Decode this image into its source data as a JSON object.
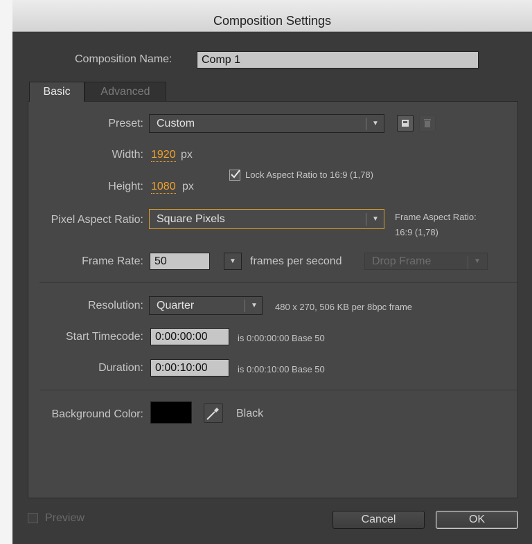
{
  "dialog": {
    "title": "Composition Settings"
  },
  "composition_name": {
    "label": "Composition Name:",
    "value": "Comp 1"
  },
  "tabs": [
    {
      "label": "Basic",
      "active": true
    },
    {
      "label": "Advanced",
      "active": false
    }
  ],
  "basic": {
    "preset": {
      "label": "Preset:",
      "value": "Custom"
    },
    "width": {
      "label": "Width:",
      "value": "1920",
      "unit": "px"
    },
    "height": {
      "label": "Height:",
      "value": "1080",
      "unit": "px"
    },
    "lock_aspect": {
      "label": "Lock Aspect Ratio to 16:9 (1,78)",
      "checked": true
    },
    "pixel_aspect": {
      "label": "Pixel Aspect Ratio:",
      "value": "Square Pixels"
    },
    "frame_aspect": {
      "label": "Frame Aspect Ratio:",
      "value": "16:9 (1,78)"
    },
    "frame_rate": {
      "label": "Frame Rate:",
      "value": "50",
      "suffix": "frames per second",
      "drop_frame": "Drop Frame"
    },
    "resolution": {
      "label": "Resolution:",
      "value": "Quarter",
      "info": "480 x 270, 506 KB per 8bpc frame"
    },
    "start_timecode": {
      "label": "Start Timecode:",
      "value": "0:00:00:00",
      "info": "is 0:00:00:00  Base 50"
    },
    "duration": {
      "label": "Duration:",
      "value": "0:00:10:00",
      "info": "is 0:00:10:00  Base 50"
    },
    "background": {
      "label": "Background Color:",
      "name": "Black",
      "color": "#000000"
    }
  },
  "footer": {
    "preview_label": "Preview",
    "cancel_label": "Cancel",
    "ok_label": "OK"
  },
  "colors": {
    "accent_orange": "#f1a22a",
    "focus_outline": "#d79a2a"
  },
  "icons": {
    "preset_save": "save-preset-icon",
    "preset_delete": "trash-icon",
    "eyedropper": "eyedropper-icon",
    "check": "checkmark-icon",
    "dropdown": "chevron-down-icon"
  }
}
